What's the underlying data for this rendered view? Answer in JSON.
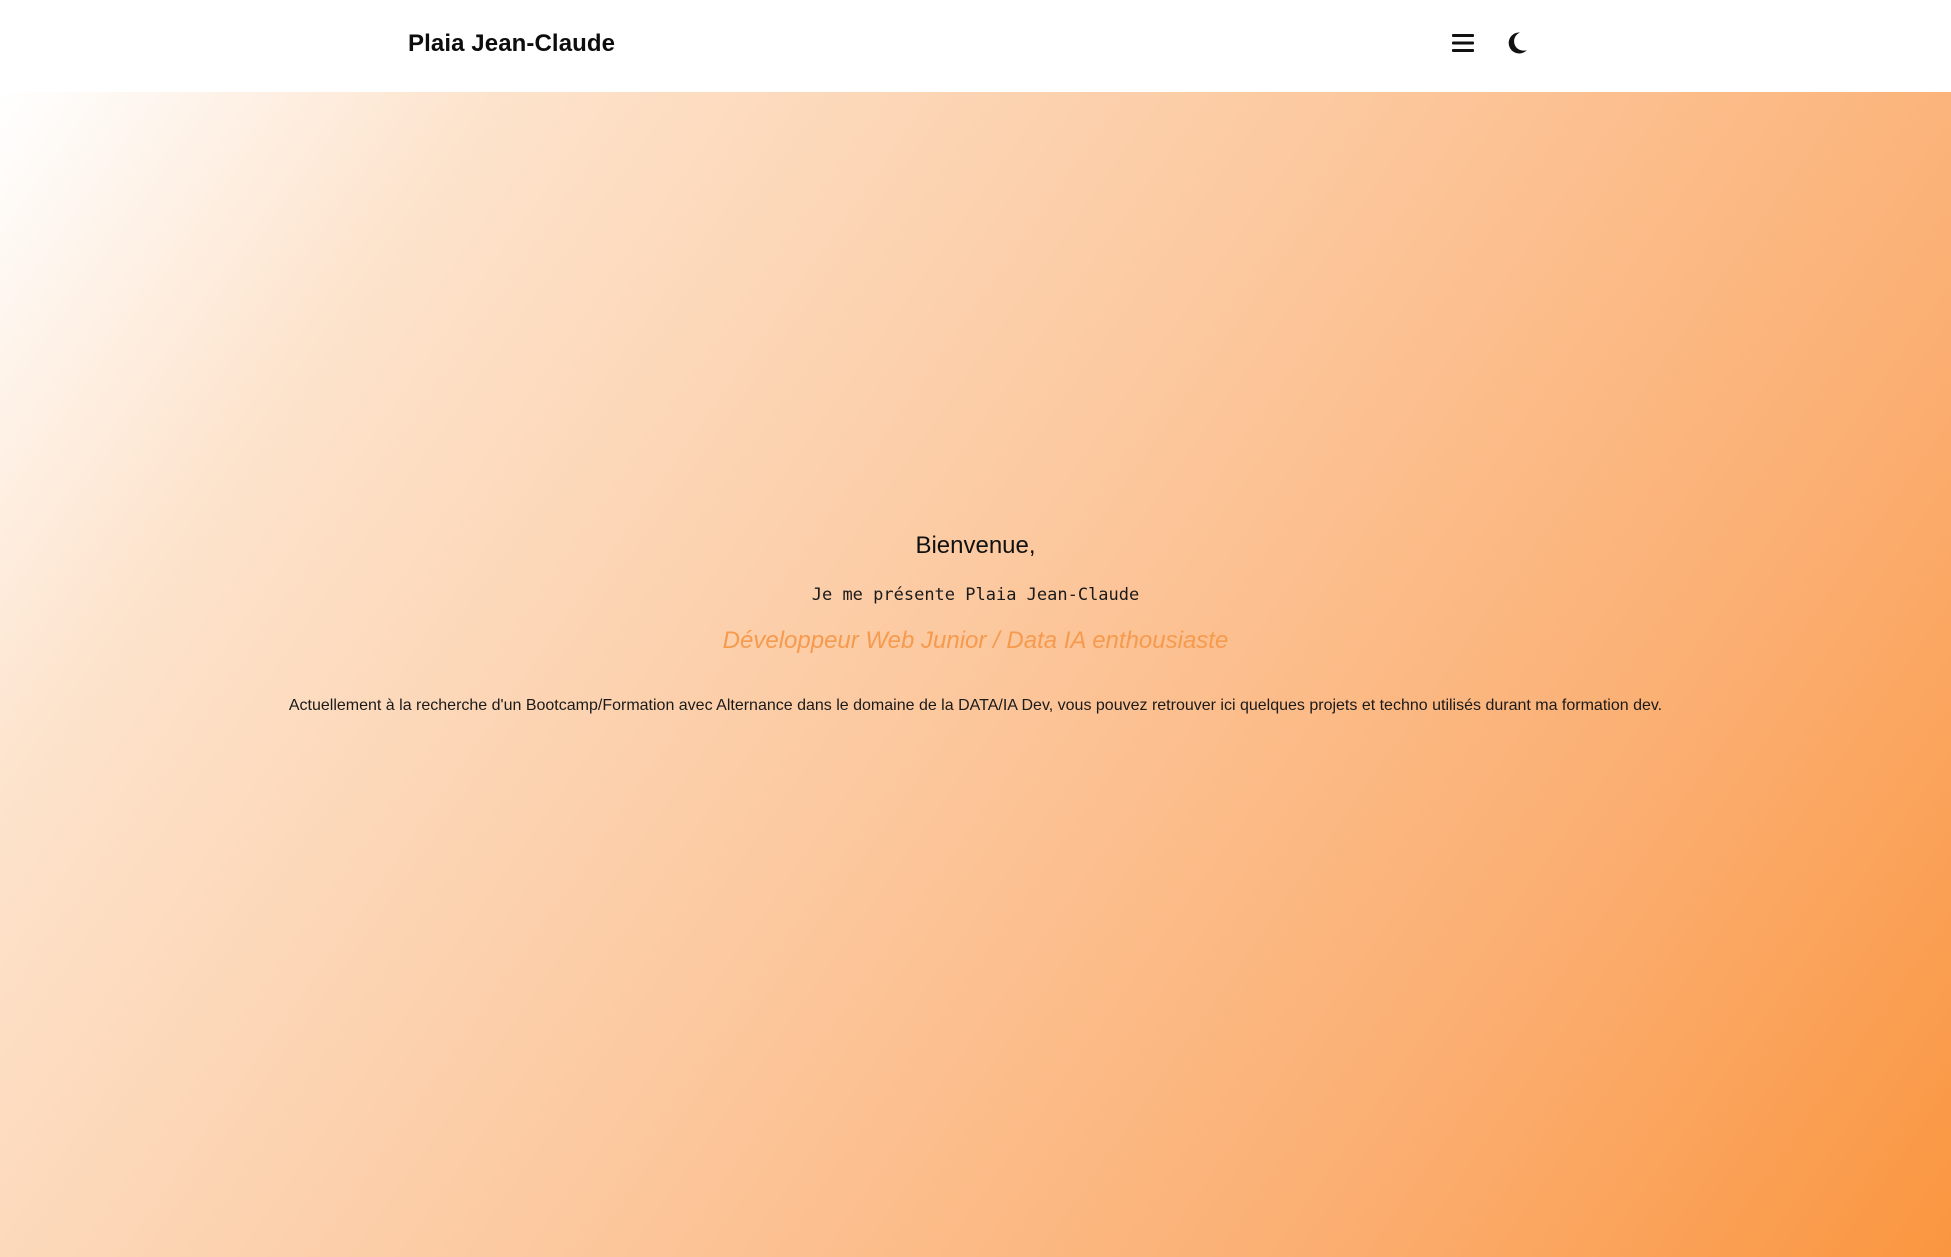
{
  "header": {
    "brand": "Plaia Jean-Claude",
    "menu_icon": "hamburger-menu-icon",
    "theme_icon": "moon-icon"
  },
  "hero": {
    "welcome": "Bienvenue,",
    "intro": "Je me présente Plaia Jean-Claude",
    "role": "Développeur Web Junior / Data IA enthousiaste",
    "description": "Actuellement à la recherche d'un Bootcamp/Formation avec Alternance dans le domaine de la DATA/IA Dev, vous pouvez retrouver ici quelques projets et techno utilisés durant ma formation dev."
  },
  "colors": {
    "accent": "#f69a4e",
    "gradient_start": "#ffffff",
    "gradient_end": "#fa9640",
    "text": "#111111"
  }
}
